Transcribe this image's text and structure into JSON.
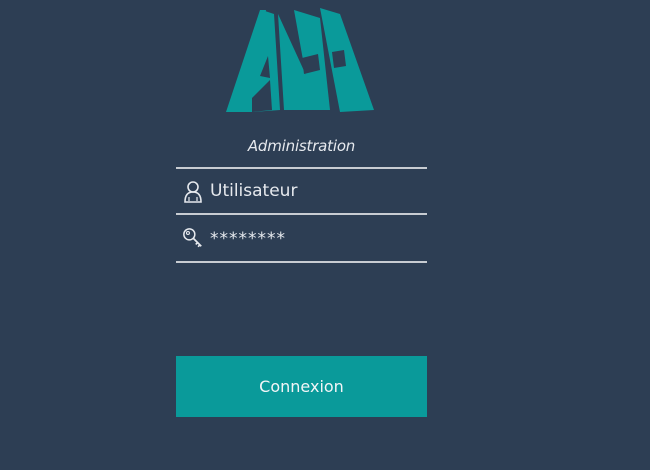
{
  "brand": {
    "logo_color": "#0a9a9a",
    "background_color": "#2d3e54"
  },
  "subtitle": "Administration",
  "username": {
    "placeholder": "Utilisateur",
    "value": "",
    "icon": "user-icon"
  },
  "password": {
    "value": "********",
    "icon": "key-icon"
  },
  "login_button": {
    "label": "Connexion",
    "color": "#0a9a9a"
  }
}
